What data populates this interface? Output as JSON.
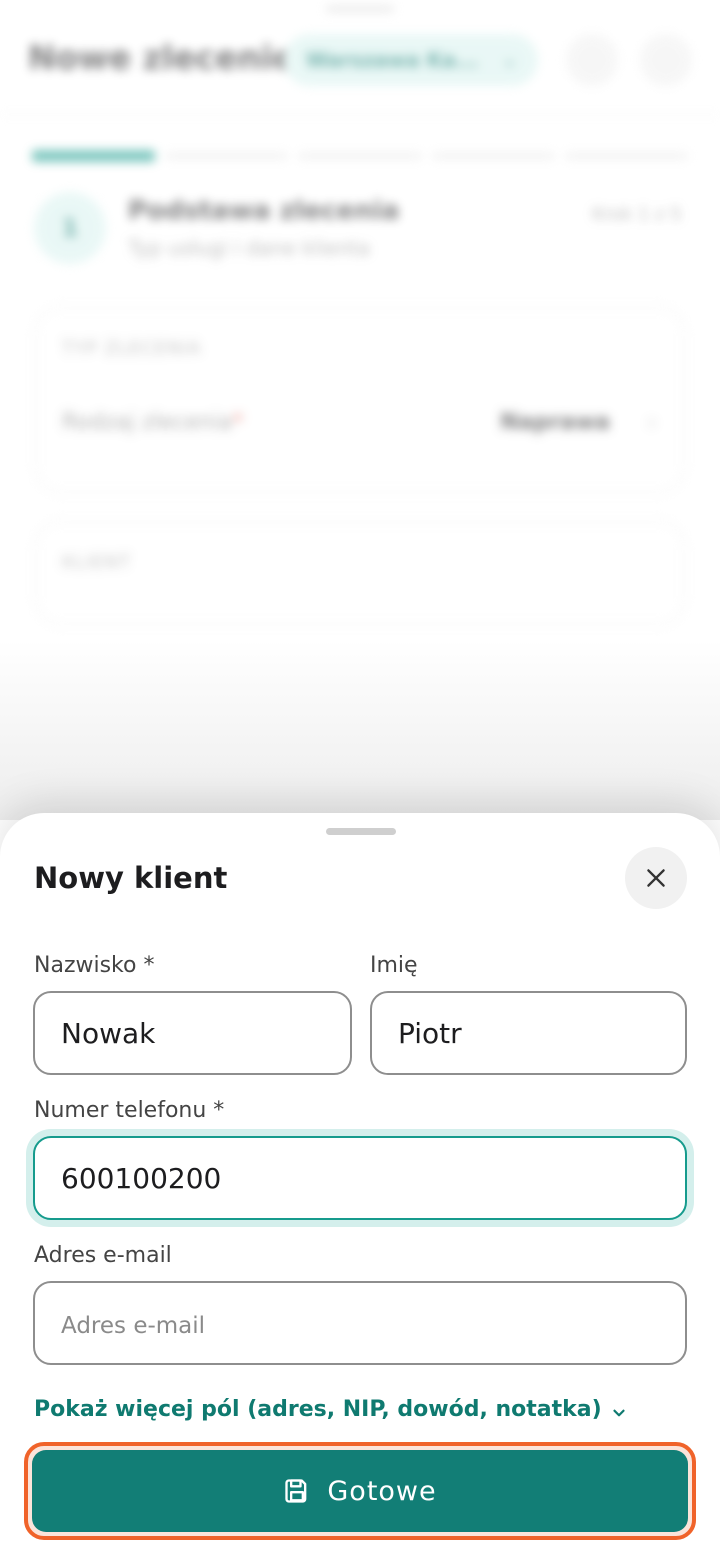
{
  "background": {
    "title": "Nowe zlecenie",
    "location_pill": "Warszawa Ka...",
    "step_number": "1",
    "step_title": "Podstawa zlecenia",
    "step_subtitle": "Typ usługi i dane klienta",
    "step_count": "Krok 1 z 5",
    "card1_label": "TYP ZLECENIA",
    "card1_row_label": "Rodzaj zlecenia",
    "card1_row_required": "*",
    "card1_row_value": "Naprawa",
    "card2_label": "KLIENT"
  },
  "sheet": {
    "title": "Nowy klient",
    "close_icon": "close-icon",
    "fields": {
      "last_name": {
        "label": "Nazwisko *",
        "value": "Nowak"
      },
      "first_name": {
        "label": "Imię",
        "value": "Piotr"
      },
      "phone": {
        "label": "Numer telefonu *",
        "value": "600100200"
      },
      "email": {
        "label": "Adres e-mail",
        "value": "",
        "placeholder": "Adres e-mail"
      }
    },
    "more_fields_link": "Pokaż więcej pól (adres, NIP, dowód, notatka)",
    "done_button": "Gotowe"
  },
  "colors": {
    "accent": "#127e76",
    "accent_light": "#d4efec",
    "highlight_border": "#f0632a"
  }
}
